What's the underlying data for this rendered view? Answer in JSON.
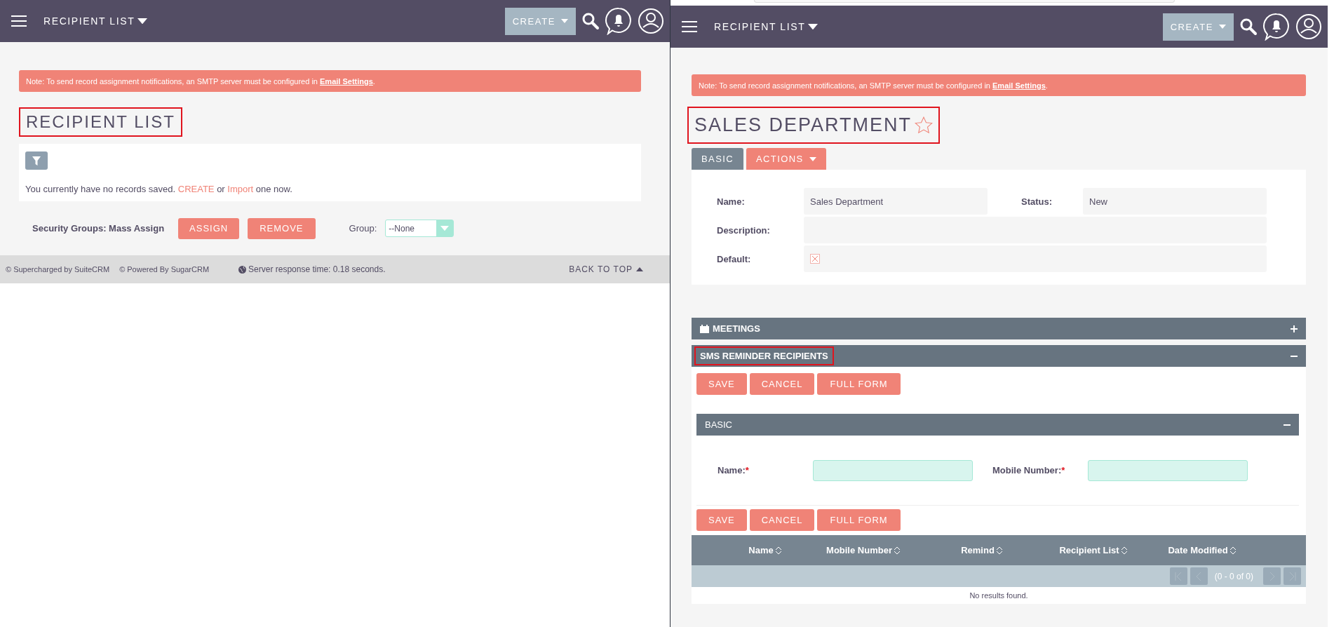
{
  "list_window": {
    "nav": {
      "module": "RECIPIENT LIST",
      "create": "CREATE"
    },
    "alert": {
      "text": "Note: To send record assignment notifications, an SMTP server must be configured in ",
      "link": "Email Settings",
      "tail": "."
    },
    "title": {
      "text": "RECIPIENT LIST",
      "highlighted": true
    },
    "empty_message": {
      "text": "You currently have no records saved. ",
      "create_link": "CREATE",
      "middle": " or ",
      "import_link": "Import",
      "tail": " one now."
    },
    "mass_assign": {
      "label": "Security Groups: Mass Assign",
      "buttons": [
        "ASSIGN",
        "REMOVE"
      ],
      "group_label": "Group:",
      "group_value": "--None"
    },
    "footer": {
      "credits": [
        "© Supercharged by SuiteCRM",
        "© Powered By SugarCRM"
      ],
      "response": "Server response time: 0.18 seconds.",
      "back_to_top": "BACK TO TOP"
    }
  },
  "detail_window": {
    "nav": {
      "module": "RECIPIENT LIST",
      "create": "CREATE"
    },
    "alert": {
      "text": "Note: To send record assignment notifications, an SMTP server must be configured in ",
      "link": "Email Settings",
      "tail": "."
    },
    "title": {
      "text": "SALES DEPARTMENT",
      "highlighted": true,
      "favorite": false
    },
    "tabs": [
      {
        "label": "BASIC",
        "selected": true,
        "kind": "tab"
      },
      {
        "label": "ACTIONS",
        "selected": false,
        "kind": "menu"
      }
    ],
    "fields": [
      {
        "kind": "text",
        "label": "Name:",
        "value": "Sales Department"
      },
      {
        "kind": "text",
        "label": "Status:",
        "value": "New"
      },
      {
        "kind": "wide",
        "label": "Description:"
      },
      {
        "kind": "checkbox",
        "label": "Default:"
      }
    ],
    "subpanels": [
      {
        "title": "MEETINGS",
        "expanded": false,
        "highlighted": false,
        "kind": "meetings"
      },
      {
        "title": "SMS REMINDER RECIPIENTS",
        "expanded": true,
        "highlighted": true,
        "kind": "plain"
      }
    ],
    "quick_form": {
      "buttons": [
        "SAVE",
        "CANCEL",
        "FULL FORM"
      ],
      "section": {
        "title": "BASIC",
        "expanded": true
      },
      "fields": [
        {
          "label": "Name:",
          "required_mark": "*"
        },
        {
          "label": "Mobile Number:",
          "required_mark": "*"
        }
      ],
      "bottom_buttons": [
        "SAVE",
        "CANCEL",
        "FULL FORM"
      ]
    },
    "table": {
      "columns": [
        "Name",
        "Mobile Number",
        "Remind",
        "Recipient List",
        "Date Modified"
      ],
      "pager": {
        "text": "(0 - 0 of 0)",
        "buttons_disabled": true
      },
      "empty": "No results found."
    }
  }
}
